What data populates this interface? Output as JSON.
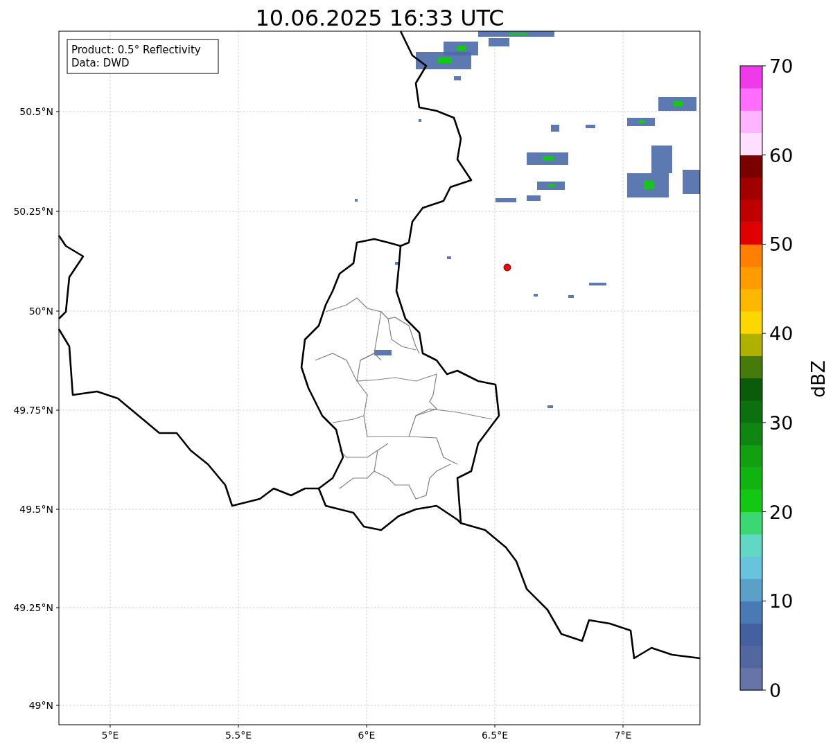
{
  "title": "10.06.2025 16:33 UTC",
  "info_box": [
    "Product: 0.5° Reflectivity",
    "Data: DWD"
  ],
  "lat_ticks": [
    "50.5°N",
    "50.25°N",
    "50°N",
    "49.75°N",
    "49.5°N",
    "49.25°N",
    "49°N"
  ],
  "lon_ticks": [
    "5°E",
    "5.5°E",
    "6°E",
    "6.5°E",
    "7°E"
  ],
  "colorbar": {
    "label": "dBZ",
    "ticks": [
      "70",
      "60",
      "50",
      "40",
      "30",
      "20",
      "10",
      "0"
    ],
    "segments": [
      {
        "color": "#6674a8"
      },
      {
        "color": "#52679f"
      },
      {
        "color": "#4560a0"
      },
      {
        "color": "#4a7ab3"
      },
      {
        "color": "#5aa0c8"
      },
      {
        "color": "#68c4dc"
      },
      {
        "color": "#62d8c4"
      },
      {
        "color": "#3cd672"
      },
      {
        "color": "#12c812"
      },
      {
        "color": "#10b410"
      },
      {
        "color": "#10a010"
      },
      {
        "color": "#0e8610"
      },
      {
        "color": "#0c700e"
      },
      {
        "color": "#0a5c0a"
      },
      {
        "color": "#467a0a"
      },
      {
        "color": "#b0b000"
      },
      {
        "color": "#ffd700"
      },
      {
        "color": "#ffb800"
      },
      {
        "color": "#ff9c00"
      },
      {
        "color": "#ff7f00"
      },
      {
        "color": "#e00000"
      },
      {
        "color": "#c00000"
      },
      {
        "color": "#a00000"
      },
      {
        "color": "#7a0000"
      },
      {
        "color": "#ffdfff"
      },
      {
        "color": "#ffb4ff"
      },
      {
        "color": "#ff6eff"
      },
      {
        "color": "#ee3ae8"
      }
    ]
  }
}
